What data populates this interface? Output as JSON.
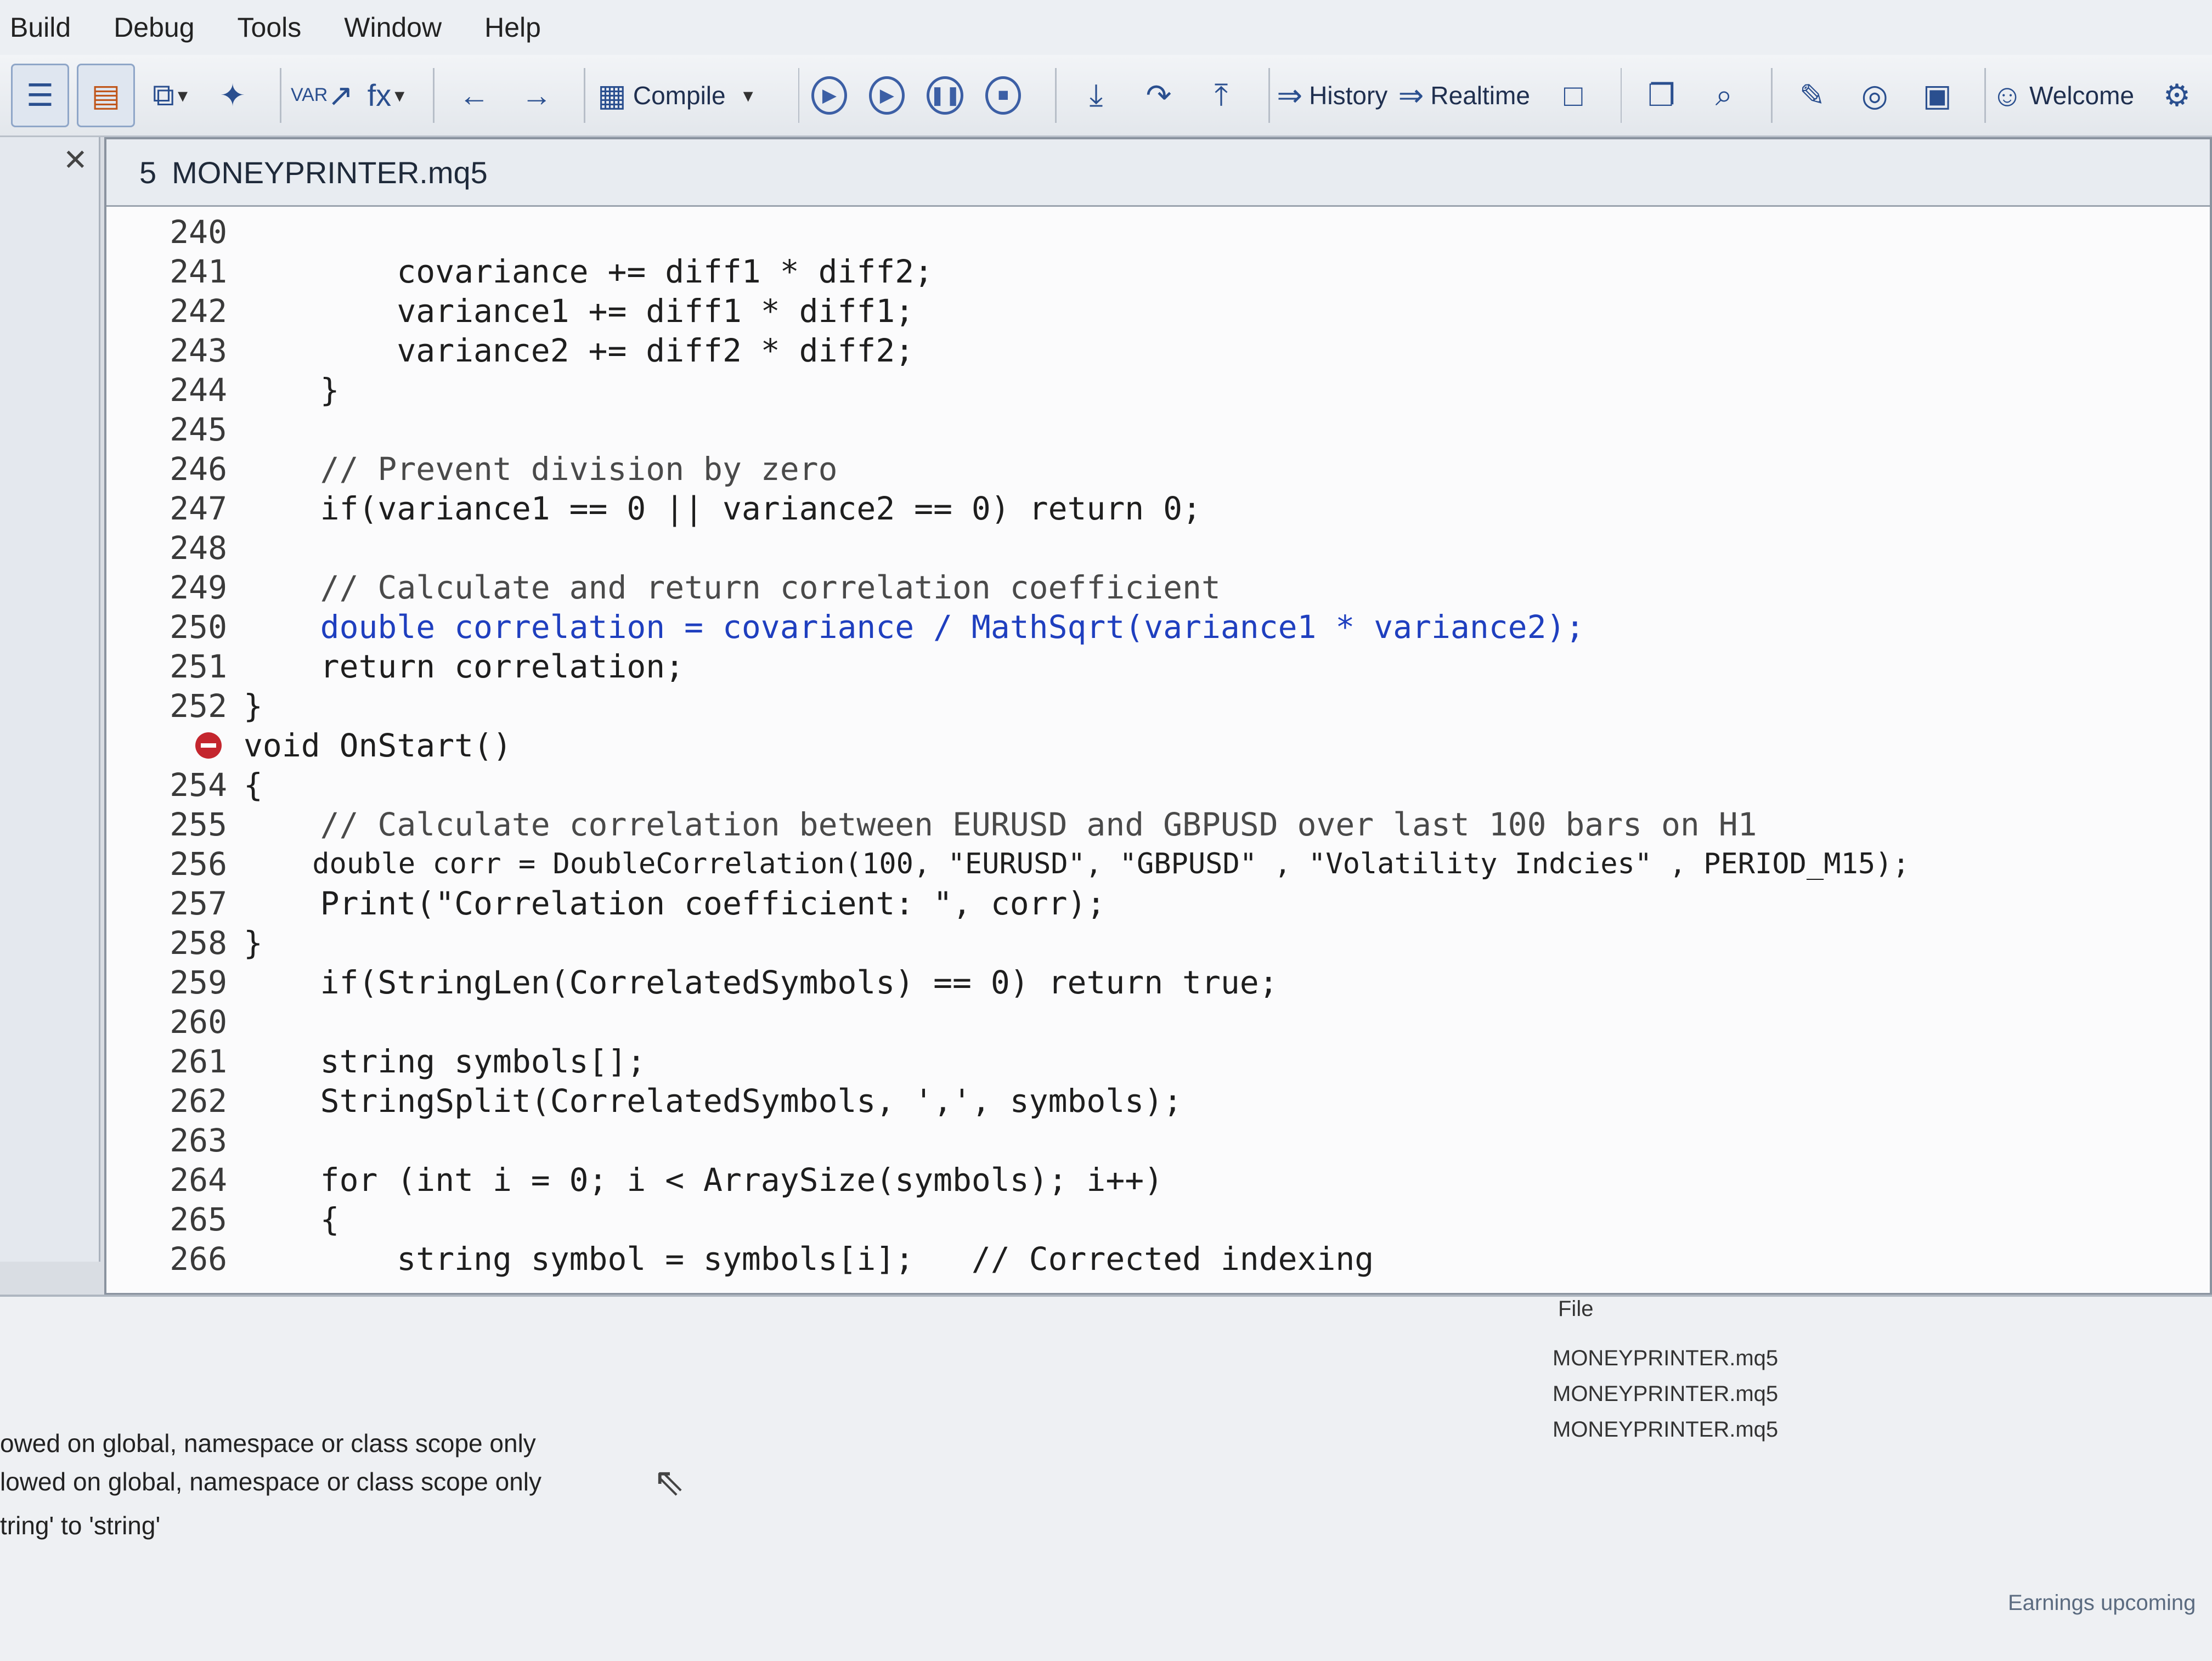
{
  "menu": [
    "Build",
    "Debug",
    "Tools",
    "Window",
    "Help"
  ],
  "toolbar": {
    "compile_label": "Compile",
    "history_label": "History",
    "realtime_label": "Realtime",
    "welcome_label": "Welcome",
    "var_label": "VAR",
    "fx_label": "fx"
  },
  "editor": {
    "tab_number": "5",
    "tab_title": "MONEYPRINTER.mq5"
  },
  "code_lines": [
    {
      "n": "240",
      "code": ""
    },
    {
      "n": "241",
      "code": "        covariance += diff1 * diff2;"
    },
    {
      "n": "242",
      "code": "        variance1 += diff1 * diff1;"
    },
    {
      "n": "243",
      "code": "        variance2 += diff2 * diff2;"
    },
    {
      "n": "244",
      "code": "    }"
    },
    {
      "n": "245",
      "code": ""
    },
    {
      "n": "246",
      "code": "    // Prevent division by zero"
    },
    {
      "n": "247",
      "code": "    if(variance1 == 0 || variance2 == 0) return 0;"
    },
    {
      "n": "248",
      "code": ""
    },
    {
      "n": "249",
      "code": "    // Calculate and return correlation coefficient"
    },
    {
      "n": "250",
      "code": "    double correlation = covariance / MathSqrt(variance1 * variance2);"
    },
    {
      "n": "251",
      "code": "    return correlation;"
    },
    {
      "n": "252",
      "code": "}"
    },
    {
      "n": "",
      "code": "void OnStart()"
    },
    {
      "n": "254",
      "code": "{"
    },
    {
      "n": "255",
      "code": "    // Calculate correlation between EURUSD and GBPUSD over last 100 bars on H1"
    },
    {
      "n": "256",
      "code": "    double corr = DoubleCorrelation(100, \"EURUSD\", \"GBPUSD\" , \"Volatility Indcies\" , PERIOD_M15);"
    },
    {
      "n": "257",
      "code": "    Print(\"Correlation coefficient: \", corr);"
    },
    {
      "n": "258",
      "code": "}"
    },
    {
      "n": "259",
      "code": "    if(StringLen(CorrelatedSymbols) == 0) return true;"
    },
    {
      "n": "260",
      "code": ""
    },
    {
      "n": "261",
      "code": "    string symbols[];"
    },
    {
      "n": "262",
      "code": "    StringSplit(CorrelatedSymbols, ',', symbols);"
    },
    {
      "n": "263",
      "code": ""
    },
    {
      "n": "264",
      "code": "    for (int i = 0; i < ArraySize(symbols); i++)"
    },
    {
      "n": "265",
      "code": "    {"
    },
    {
      "n": "266",
      "code": "        string symbol = symbols[i];   // Corrected indexing"
    }
  ],
  "toolbox": {
    "file_header": "File",
    "files": [
      "MONEYPRINTER.mq5",
      "MONEYPRINTER.mq5",
      "MONEYPRINTER.mq5"
    ],
    "errors": [
      "owed on global, namespace or class scope only",
      "lowed on global, namespace or class scope only",
      "tring' to 'string'"
    ],
    "status_right": "Earnings upcoming"
  },
  "colors": {
    "keyword": "#1f3fbf",
    "function": "#2d5ac8",
    "constant": "#b0222b",
    "breakpoint": "#c4262e"
  }
}
